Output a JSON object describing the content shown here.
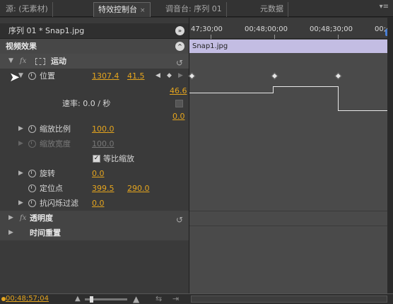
{
  "tabs": [
    {
      "label": "源: (无素材)",
      "active": false
    },
    {
      "label": "特效控制台",
      "active": true,
      "close": "×"
    },
    {
      "label": "调音台: 序列 01",
      "active": false
    },
    {
      "label": "元数据",
      "active": false
    }
  ],
  "panel_menu": "▾≡",
  "sequence": {
    "label": "序列 01 * Snap1.jpg"
  },
  "video_effects": {
    "label": "视频效果"
  },
  "motion": {
    "label": "运动",
    "position": {
      "label": "位置",
      "x": "1307.4",
      "y": "41.5"
    },
    "velocity": {
      "label": "速率: 0.0 / 秒",
      "max": "46.6",
      "min": "0.0"
    },
    "scale": {
      "label": "缩放比例",
      "value": "100.0"
    },
    "scale_width": {
      "label": "缩放宽度",
      "value": "100.0"
    },
    "uniform_scale": {
      "label": "等比缩放",
      "checked": true
    },
    "rotation": {
      "label": "旋转",
      "value": "0.0"
    },
    "anchor": {
      "label": "定位点",
      "x": "399.5",
      "y": "290.0"
    },
    "antiflicker": {
      "label": "抗闪烁过滤",
      "value": "0.0"
    }
  },
  "opacity": {
    "label": "透明度"
  },
  "time_remap": {
    "label": "时间重置"
  },
  "ruler": {
    "labels": [
      "47;30;00",
      "00;48;00;00",
      "00;48;30;00",
      "00;4"
    ]
  },
  "clip": {
    "label": "Snap1.jpg"
  },
  "timecode": "00;48;57;04",
  "colors": {
    "accent_value": "#e5a51e",
    "clip_bar": "#c3bde3",
    "playhead": "#d42b2b"
  }
}
